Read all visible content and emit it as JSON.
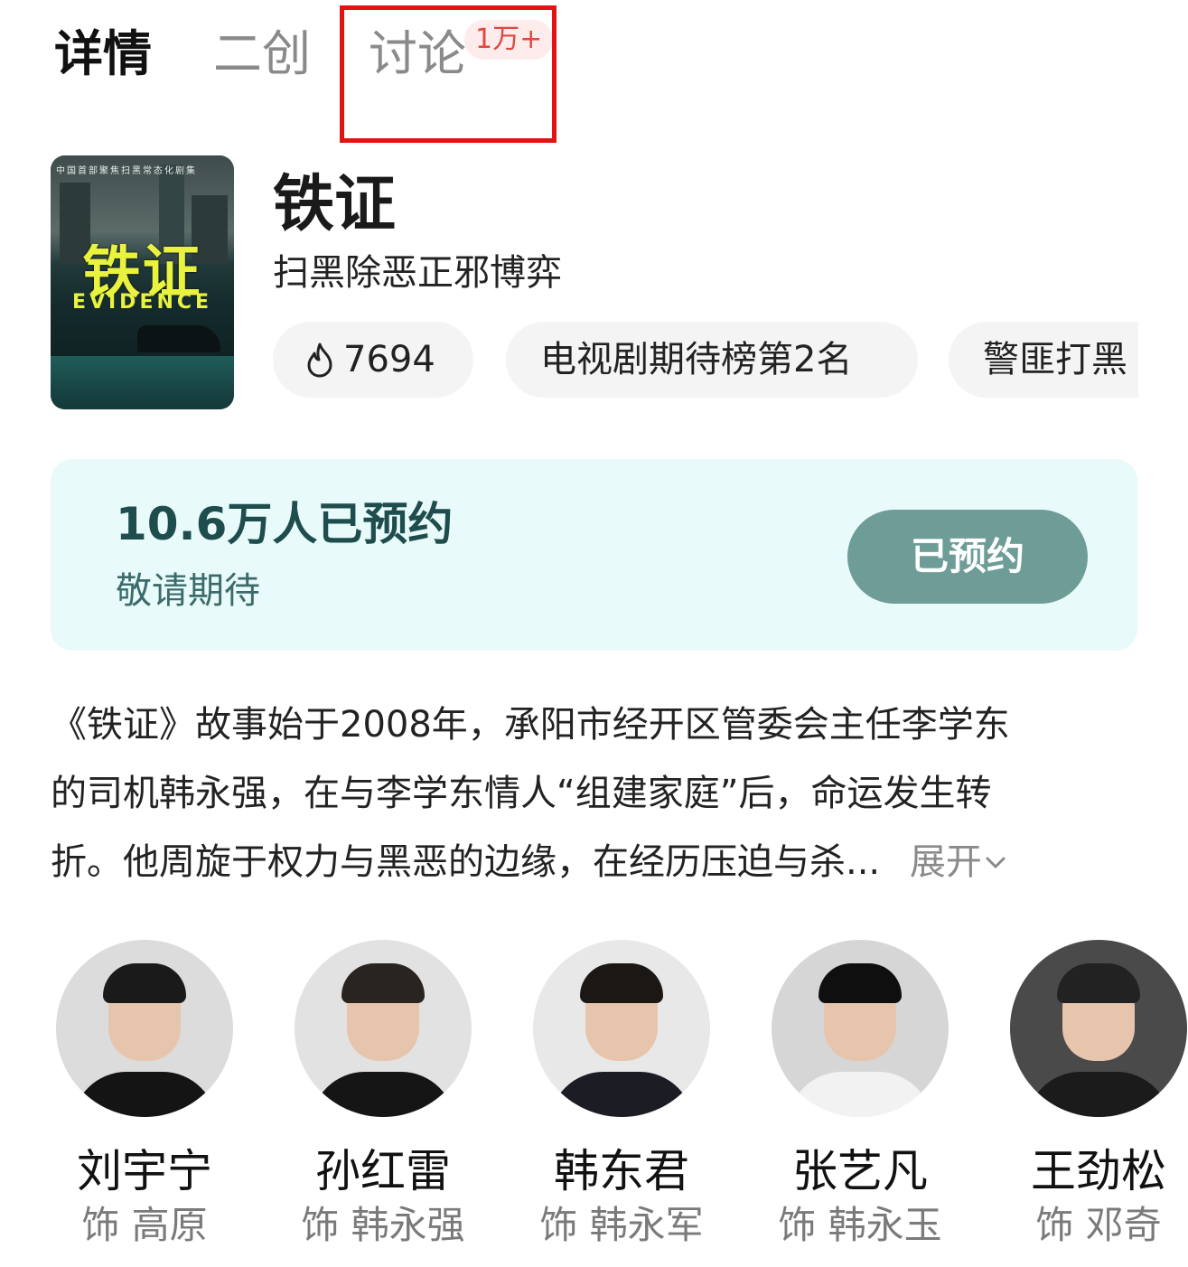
{
  "tabs": [
    {
      "label": "详情",
      "active": true
    },
    {
      "label": "二创",
      "active": false
    },
    {
      "label": "讨论",
      "active": false,
      "badge": "1万+"
    }
  ],
  "show": {
    "title": "铁证",
    "subtitle": "扫黑除恶正邪博弈",
    "poster": {
      "tagline": "中国首部聚焦扫黑常态化剧集",
      "title_text": "铁证",
      "subtitle_text": "EVIDENCE"
    },
    "chips": [
      {
        "icon": "flame-icon",
        "label": "7694"
      },
      {
        "label": "电视剧期待榜第2名"
      },
      {
        "label": "警匪打黑"
      }
    ]
  },
  "reservation": {
    "count_text": "10.6万人已预约",
    "note": "敬请期待",
    "button_label": "已预约",
    "accent": "#6e9d98",
    "panel_bg": "#e9fafa"
  },
  "synopsis": {
    "lines": [
      "《铁证》故事始于2008年，承阳市经开区管委会主任李学东",
      "的司机韩永强，在与李学东情人“组建家庭”后，命运发生转",
      "折。他周旋于权力与黑恶的边缘，在经历压迫与杀..."
    ],
    "expand_label": "展开"
  },
  "cast": [
    {
      "name": "刘宇宁",
      "role": "饰 高原",
      "tone": {
        "hair": "#1a1a1a",
        "body": "#141414",
        "bg": "#dcdcdc"
      }
    },
    {
      "name": "孙红雷",
      "role": "饰 韩永强",
      "tone": {
        "hair": "#2a2420",
        "body": "#151515",
        "bg": "#e2e2e2"
      }
    },
    {
      "name": "韩东君",
      "role": "饰 韩永军",
      "tone": {
        "hair": "#1b1714",
        "body": "#1c1c24",
        "bg": "#e8e8e8"
      }
    },
    {
      "name": "张艺凡",
      "role": "饰 韩永玉",
      "tone": {
        "hair": "#0f0f0f",
        "body": "#f2f2f2",
        "bg": "#d6d6d6"
      }
    },
    {
      "name": "王劲松",
      "role": "饰 邓奇",
      "tone": {
        "hair": "#222222",
        "body": "#1b1b1b",
        "bg": "#4a4a4a"
      }
    }
  ]
}
